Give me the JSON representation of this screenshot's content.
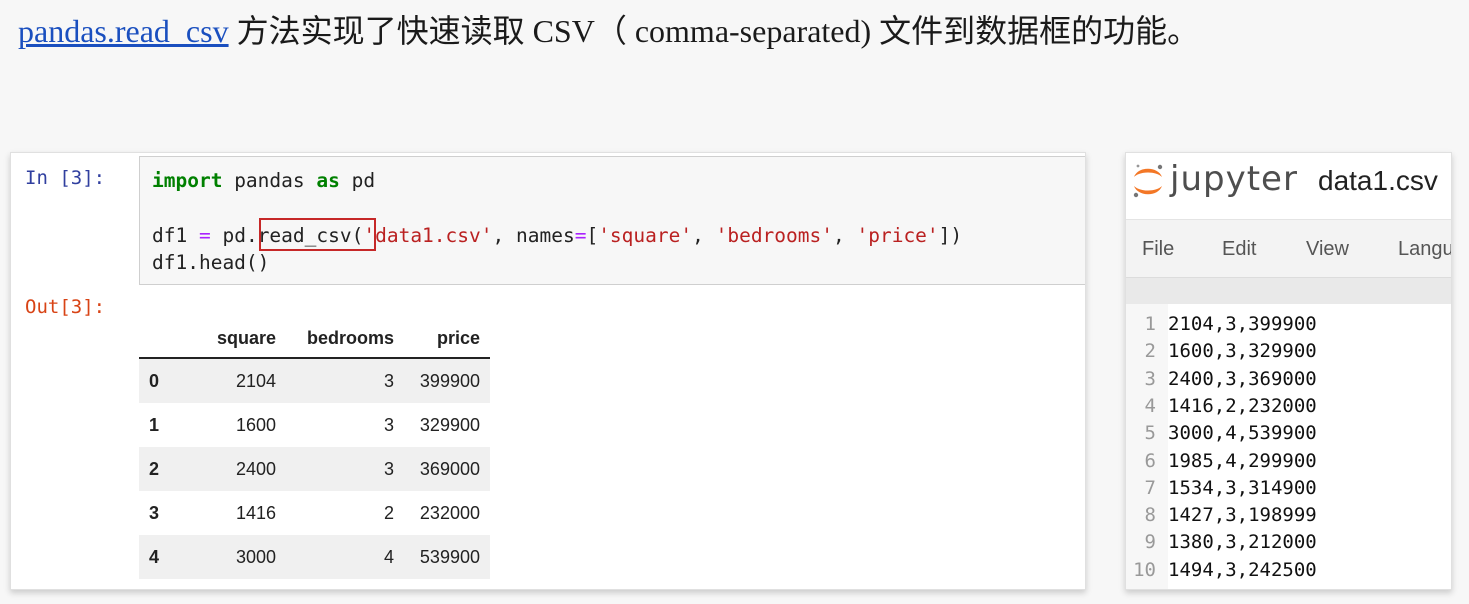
{
  "headline": {
    "link_text": "pandas.read_csv",
    "rest_text": " 方法实现了快速读取 CSV（ comma-separated) 文件到数据框的功能。"
  },
  "notebook": {
    "in_prompt": "In [3]:",
    "out_prompt": "Out[3]:",
    "code": {
      "line1_kw1": "import",
      "line1_mid": " pandas ",
      "line1_kw2": "as",
      "line1_end": " pd",
      "line2_a": "df1 ",
      "line2_eq": "=",
      "line2_b": " pd.",
      "line2_fn": "read_csv",
      "line2_c": "(",
      "line2_s1": "'data1.csv'",
      "line2_d": ", names",
      "line2_eq2": "=",
      "line2_e": "[",
      "line2_s2": "'square'",
      "line2_f": ", ",
      "line2_s3": "'bedrooms'",
      "line2_g": ", ",
      "line2_s4": "'price'",
      "line2_h": "])",
      "line3": "df1.head()"
    },
    "dataframe": {
      "columns": [
        "square",
        "bedrooms",
        "price"
      ],
      "rows": [
        {
          "index": "0",
          "square": "2104",
          "bedrooms": "3",
          "price": "399900"
        },
        {
          "index": "1",
          "square": "1600",
          "bedrooms": "3",
          "price": "329900"
        },
        {
          "index": "2",
          "square": "2400",
          "bedrooms": "3",
          "price": "369000"
        },
        {
          "index": "3",
          "square": "1416",
          "bedrooms": "2",
          "price": "232000"
        },
        {
          "index": "4",
          "square": "3000",
          "bedrooms": "4",
          "price": "539900"
        }
      ]
    }
  },
  "jupyter": {
    "brand": "jupyter",
    "filename": "data1.csv",
    "menu": [
      "File",
      "Edit",
      "View",
      "Langu"
    ],
    "lines": [
      {
        "n": "1",
        "text": "2104,3,399900"
      },
      {
        "n": "2",
        "text": "1600,3,329900"
      },
      {
        "n": "3",
        "text": "2400,3,369000"
      },
      {
        "n": "4",
        "text": "1416,2,232000"
      },
      {
        "n": "5",
        "text": "3000,4,539900"
      },
      {
        "n": "6",
        "text": "1985,4,299900"
      },
      {
        "n": "7",
        "text": "1534,3,314900"
      },
      {
        "n": "8",
        "text": "1427,3,198999"
      },
      {
        "n": "9",
        "text": "1380,3,212000"
      },
      {
        "n": "10",
        "text": "1494,3,242500"
      }
    ],
    "logo_color": "#f37726"
  }
}
